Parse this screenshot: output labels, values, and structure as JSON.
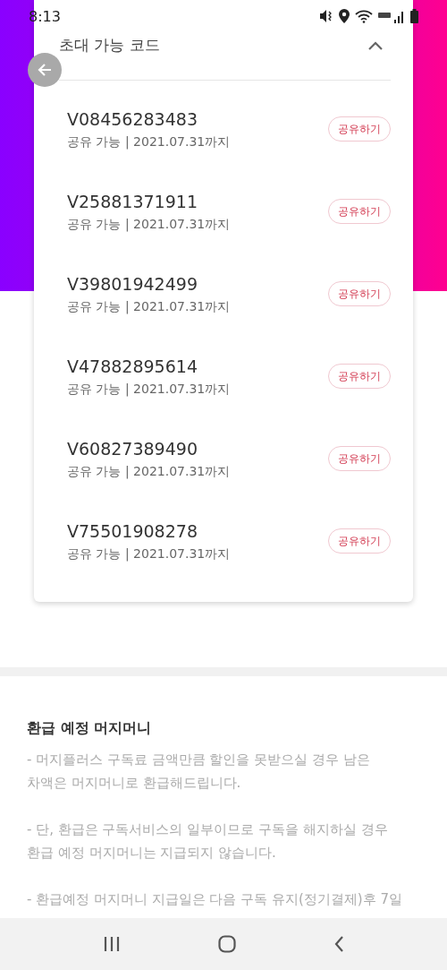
{
  "status_bar": {
    "time": "8:13"
  },
  "card": {
    "title": "초대 가능 코드",
    "expanded": true,
    "codes": [
      {
        "code": "V08456283483",
        "details": "공유 가능 | 2021.07.31까지",
        "button": "공유하기"
      },
      {
        "code": "V25881371911",
        "details": "공유 가능 | 2021.07.31까지",
        "button": "공유하기"
      },
      {
        "code": "V39801942499",
        "details": "공유 가능 | 2021.07.31까지",
        "button": "공유하기"
      },
      {
        "code": "V47882895614",
        "details": "공유 가능 | 2021.07.31까지",
        "button": "공유하기"
      },
      {
        "code": "V60827389490",
        "details": "공유 가능 | 2021.07.31까지",
        "button": "공유하기"
      },
      {
        "code": "V75501908278",
        "details": "공유 가능 | 2021.07.31까지",
        "button": "공유하기"
      }
    ]
  },
  "refund": {
    "title": "환급 예정 머지머니",
    "paragraphs": [
      "- 머지플러스 구독료 금액만큼 할인을 못받으실 경우 남은 차액은 머지머니로 환급해드립니다.",
      "- 단, 환급은 구독서비스의 일부이므로 구독을 해지하실 경우 환급 예정 머지머니는 지급되지 않습니다.",
      "- 환급예정 머지머니 지급일은 다음 구독 유지(정기결제)후 7일"
    ]
  }
}
